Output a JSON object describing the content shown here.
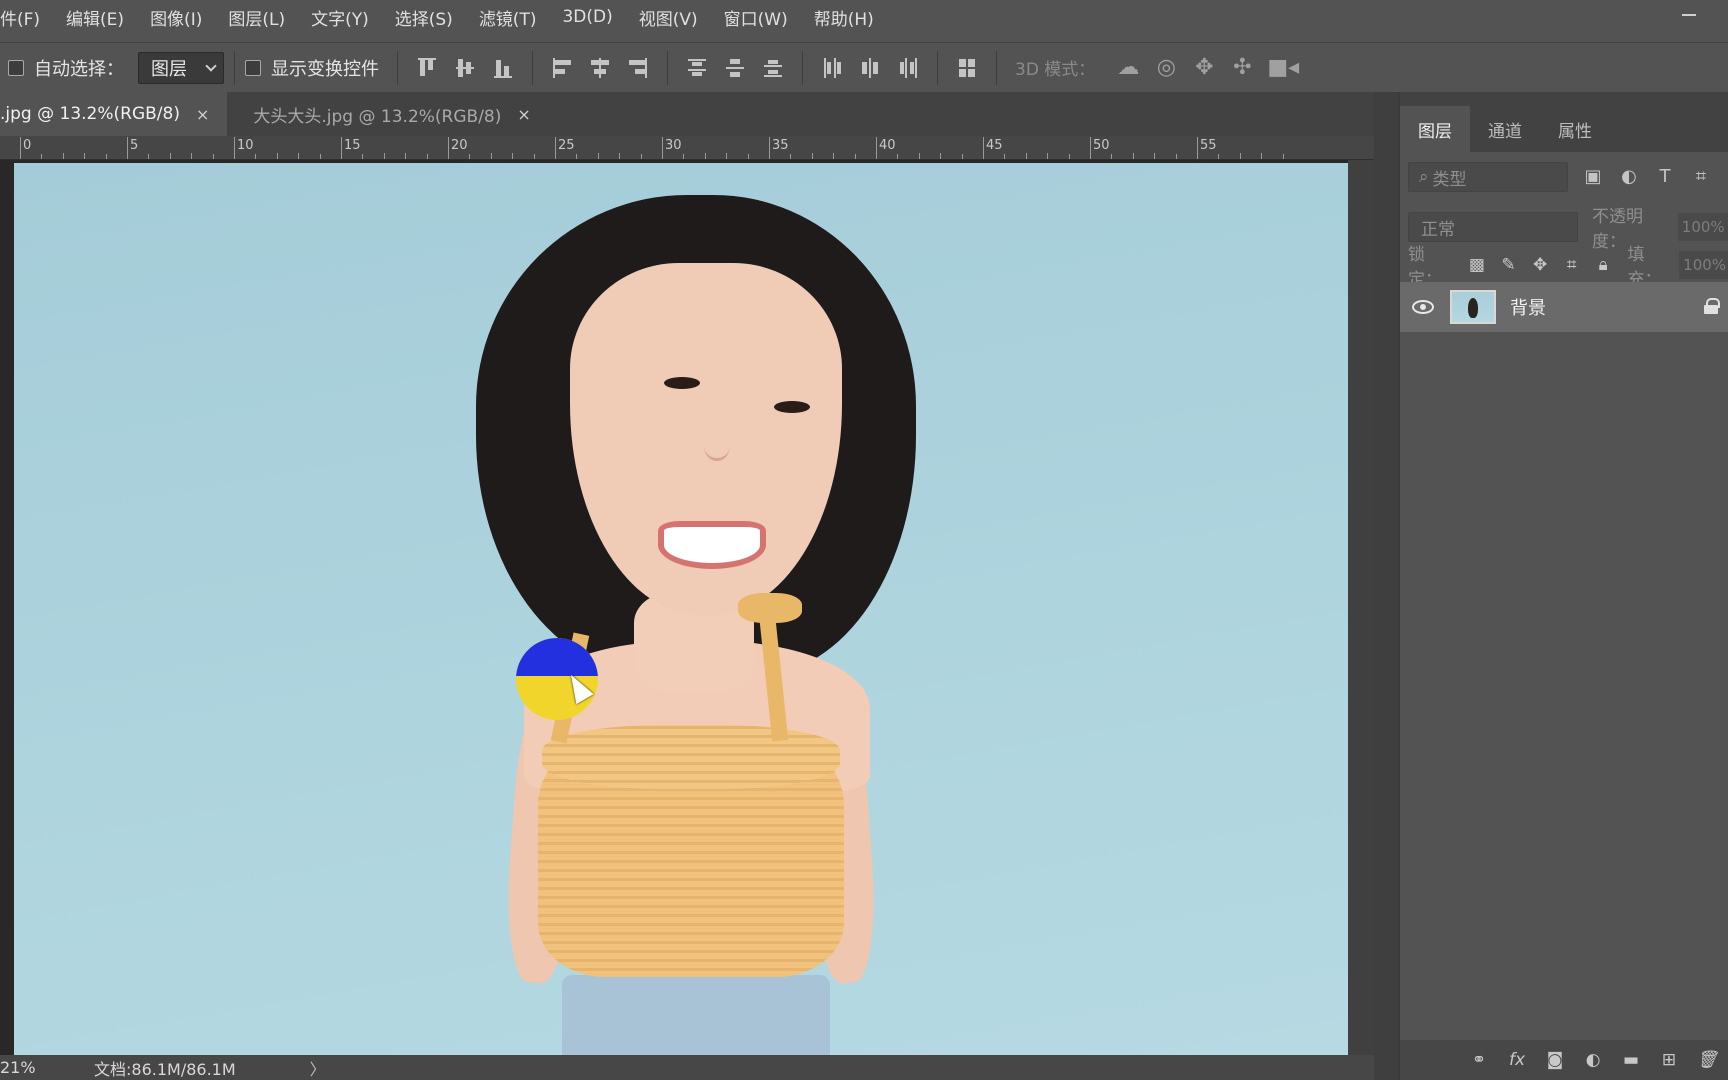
{
  "menubar": {
    "items": [
      "件(F)",
      "编辑(E)",
      "图像(I)",
      "图层(L)",
      "文字(Y)",
      "选择(S)",
      "滤镜(T)",
      "3D(D)",
      "视图(V)",
      "窗口(W)",
      "帮助(H)"
    ]
  },
  "options": {
    "auto_select_label": "自动选择：",
    "auto_select_value": "图层",
    "show_transform_label": "显示变换控件",
    "mode_3d_label": "3D 模式："
  },
  "tabs": [
    {
      "label": ".jpg @ 13.2%(RGB/8)",
      "close": "×"
    },
    {
      "label": "大头大头.jpg @ 13.2%(RGB/8)",
      "close": "×"
    }
  ],
  "ruler": {
    "labels": [
      "0",
      "5",
      "10",
      "15",
      "20",
      "25",
      "30",
      "35",
      "40",
      "45",
      "50",
      "55"
    ]
  },
  "status": {
    "zoom": "21%",
    "doc": "文档:86.1M/86.1M",
    "arrow": "〉"
  },
  "panel": {
    "tabs": [
      "图层",
      "通道",
      "属性"
    ],
    "filter_placeholder": "类型",
    "blend_mode": "正常",
    "opacity_label": "不透明度：",
    "opacity_value": "100%",
    "lock_label": "锁定：",
    "fill_label": "填充：",
    "fill_value": "100%",
    "layer_name": "背景"
  },
  "colors": {
    "accent_highlight_yellow": "#f2d52b",
    "accent_highlight_blue": "#2330e0",
    "background": "#535353"
  }
}
